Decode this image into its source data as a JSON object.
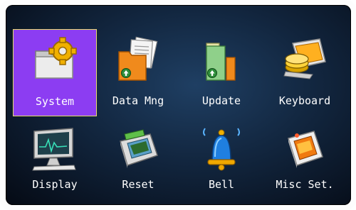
{
  "menu": {
    "selected": "system",
    "colors": {
      "selected_bg": "#8c3df2",
      "selected_border": "#e8dc6a",
      "label": "#ffffff",
      "screen_bg": "#12263f"
    },
    "items": [
      {
        "label": "System",
        "icon": "folder-gear-icon"
      },
      {
        "label": "Data Mng",
        "icon": "data-folder-icon"
      },
      {
        "label": "Update",
        "icon": "update-folder-icon"
      },
      {
        "label": "Keyboard",
        "icon": "keyboard-icon"
      },
      {
        "label": "Display",
        "icon": "monitor-icon"
      },
      {
        "label": "Reset",
        "icon": "reset-device-icon"
      },
      {
        "label": "Bell",
        "icon": "bell-icon"
      },
      {
        "label": "Misc Set.",
        "icon": "misc-settings-icon"
      }
    ]
  }
}
